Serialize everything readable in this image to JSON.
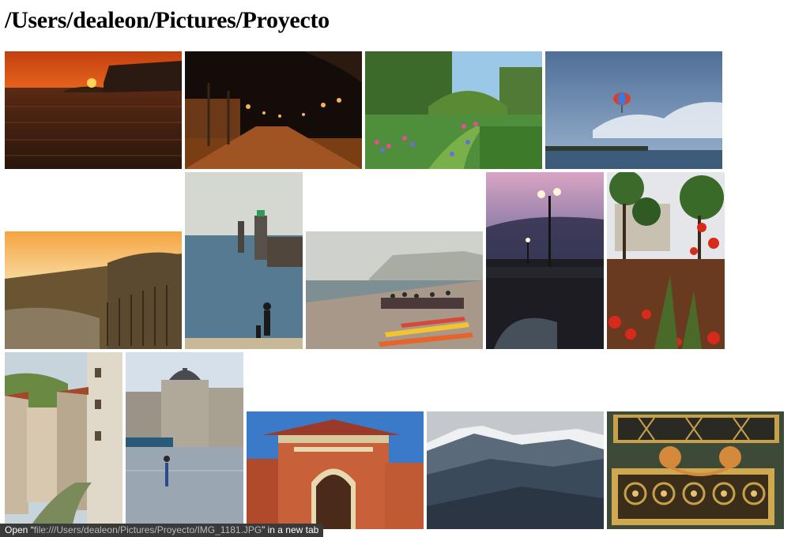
{
  "page": {
    "title": "/Users/dealeon/Pictures/Proyecto"
  },
  "gallery": {
    "photos": [
      {
        "name": "photo-sunset-sea"
      },
      {
        "name": "photo-night-street"
      },
      {
        "name": "photo-garden-flowers"
      },
      {
        "name": "photo-parasail-bay"
      },
      {
        "name": "photo-dune-sunset"
      },
      {
        "name": "photo-lighthouse-pier"
      },
      {
        "name": "photo-cliff-beach-kayaks"
      },
      {
        "name": "photo-bridge-lamp-dusk"
      },
      {
        "name": "photo-red-flowers-trees"
      },
      {
        "name": "photo-village-street"
      },
      {
        "name": "photo-square-reflection"
      },
      {
        "name": "photo-brick-gatehouse"
      },
      {
        "name": "photo-mountain-valley"
      },
      {
        "name": "photo-ornate-gate"
      }
    ]
  },
  "status_bar": {
    "prefix": "Open “",
    "url": "file:///Users/dealeon/Pictures/Proyecto/IMG_1181.JPG",
    "suffix": "” in a new tab"
  }
}
